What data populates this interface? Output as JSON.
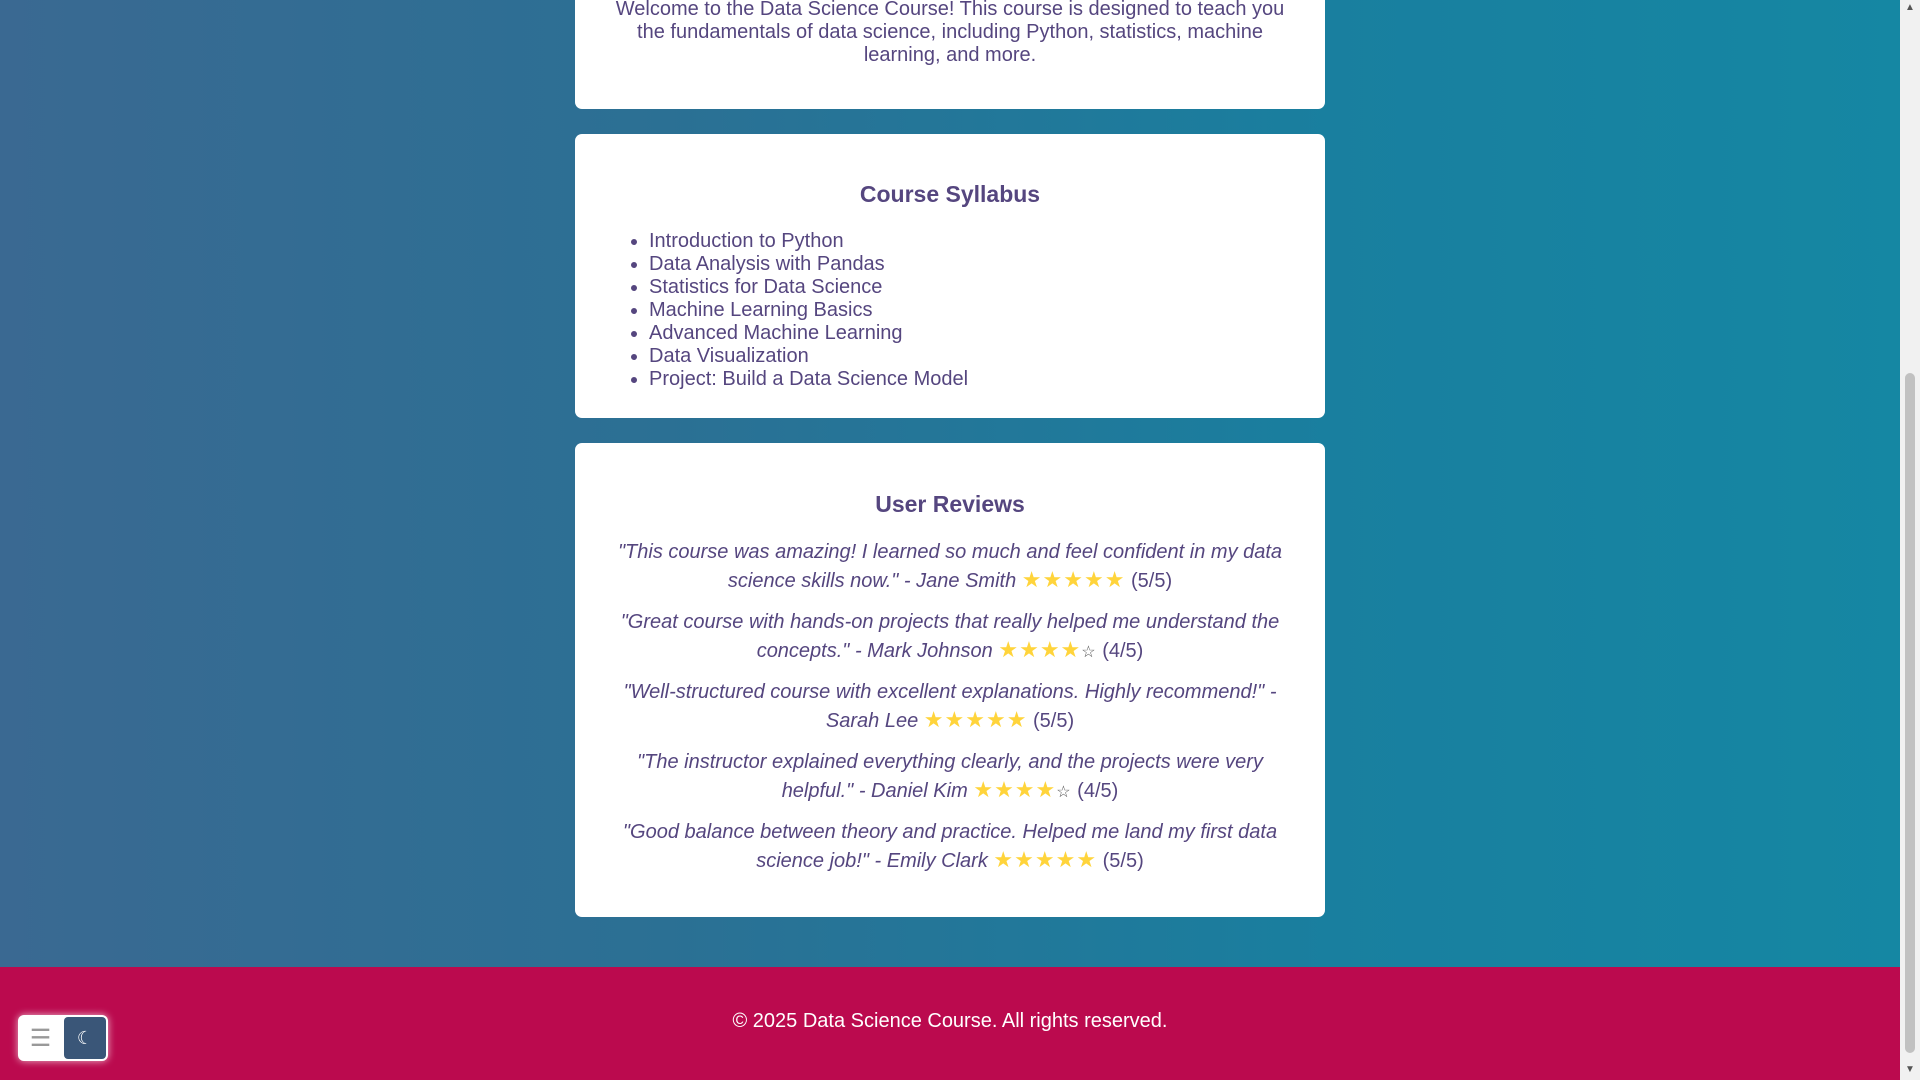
{
  "intro": {
    "text": "Welcome to the Data Science Course! This course is designed to teach you the fundamentals of data science, including Python, statistics, machine learning, and more."
  },
  "syllabus": {
    "title": "Course Syllabus",
    "items": [
      "Introduction to Python",
      "Data Analysis with Pandas",
      "Statistics for Data Science",
      "Machine Learning Basics",
      "Advanced Machine Learning",
      "Data Visualization",
      "Project: Build a Data Science Model"
    ]
  },
  "reviews": {
    "title": "User Reviews",
    "items": [
      {
        "quote": "\"This course was amazing! I learned so much and feel confident in my data science skills now.\" - Jane Smith",
        "rating": 5,
        "score": "(5/5)"
      },
      {
        "quote": "\"Great course with hands-on projects that really helped me understand the concepts.\" - Mark Johnson",
        "rating": 4,
        "score": "(4/5)"
      },
      {
        "quote": "\"Well-structured course with excellent explanations. Highly recommend!\" - Sarah Lee",
        "rating": 5,
        "score": "(5/5)"
      },
      {
        "quote": "\"The instructor explained everything clearly, and the projects were very helpful.\" - Daniel Kim",
        "rating": 4,
        "score": "(4/5)"
      },
      {
        "quote": "\"Good balance between theory and practice. Helped me land my first data science job!\" - Emily Clark",
        "rating": 5,
        "score": "(5/5)"
      }
    ]
  },
  "footer": {
    "text": "© 2025 Data Science Course. All rights reserved."
  },
  "controls": {
    "menu_icon": "hamburger-icon",
    "theme_icon": "moon-icon"
  },
  "colors": {
    "footer": "#bb0a4e",
    "heading": "#55467f",
    "star": "#ffd43b"
  }
}
